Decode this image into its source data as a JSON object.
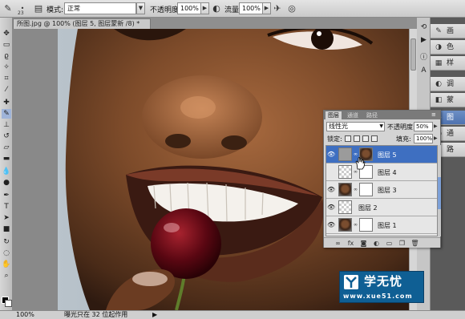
{
  "options_bar": {
    "brush_size": "23",
    "mode_label": "模式:",
    "mode_value": "正常",
    "opacity_label": "不透明度:",
    "opacity_value": "100%",
    "flow_label": "流量:",
    "flow_value": "100%"
  },
  "document": {
    "tab_title": "所图.jpg @ 100% (图层 5, 图层蒙新 /8) *"
  },
  "layers_panel": {
    "tabs": [
      "图层",
      "通道",
      "路径"
    ],
    "blend_mode": "线性光",
    "opacity_label": "不透明度:",
    "opacity_value": "50%",
    "lock_label": "锁定:",
    "fill_label": "填充:",
    "fill_value": "100%",
    "layers": [
      {
        "name": "图层 5",
        "selected": true,
        "thumb": "gray"
      },
      {
        "name": "图层 4",
        "selected": false,
        "thumb": "checker"
      },
      {
        "name": "图层 3",
        "selected": false,
        "thumb": "face"
      },
      {
        "name": "图层 2",
        "selected": false,
        "thumb": "checker"
      },
      {
        "name": "图层 1",
        "selected": false,
        "thumb": "face"
      }
    ]
  },
  "dock": {
    "panels": [
      {
        "icon": "adjust-icon",
        "label": "调"
      },
      {
        "icon": "mask-icon",
        "label": "蒙"
      },
      {
        "icon": "layers-icon",
        "label": "图",
        "active": true
      },
      {
        "icon": "channels-icon",
        "label": "通"
      },
      {
        "icon": "paths-icon",
        "label": "路"
      }
    ],
    "top_panels": [
      {
        "icon": "brush-panel-icon",
        "label": "画"
      },
      {
        "icon": "color-panel-icon",
        "label": "色"
      },
      {
        "icon": "swatches-icon",
        "label": "样"
      }
    ]
  },
  "status_bar": {
    "zoom": "100%",
    "info": "曝光只在 32 位起作用"
  },
  "watermark": {
    "title": "学无忧",
    "url": "www.xue51.com"
  },
  "colors": {
    "accent": "#3e6fc1",
    "watermark_bg": "#0f5f94"
  }
}
